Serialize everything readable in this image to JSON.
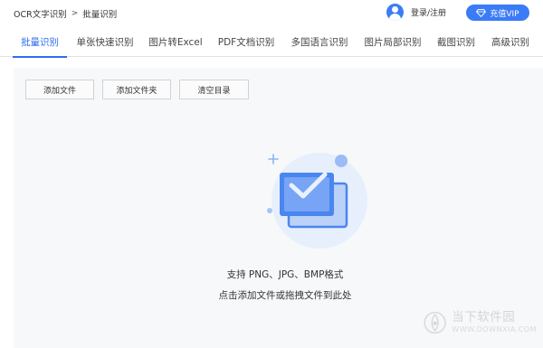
{
  "header": {
    "breadcrumb": [
      "OCR文字识别",
      ">",
      "批量识别"
    ],
    "login_label": "登录/注册",
    "vip_label": "充值VIP",
    "accent_color": "#2c6ff0"
  },
  "tabs": [
    {
      "label": "批量识别",
      "active": true
    },
    {
      "label": "单张快速识别",
      "active": false
    },
    {
      "label": "图片转Excel",
      "active": false
    },
    {
      "label": "PDF文档识别",
      "active": false
    },
    {
      "label": "多国语言识别",
      "active": false
    },
    {
      "label": "图片局部识别",
      "active": false
    },
    {
      "label": "截图识别",
      "active": false
    },
    {
      "label": "高级识别",
      "active": false
    }
  ],
  "toolbar": {
    "add_file": "添加文件",
    "add_folder": "添加文件夹",
    "clear_list": "清空目录"
  },
  "dropzone": {
    "icon": "image-check-icon",
    "formats_text": "支持 PNG、JPG、BMP格式",
    "hint_text": "点击添加文件或拖拽文件到此处"
  },
  "watermark": {
    "cn": "当下软件园",
    "en": "WWW.DOWNXIA.COM"
  }
}
